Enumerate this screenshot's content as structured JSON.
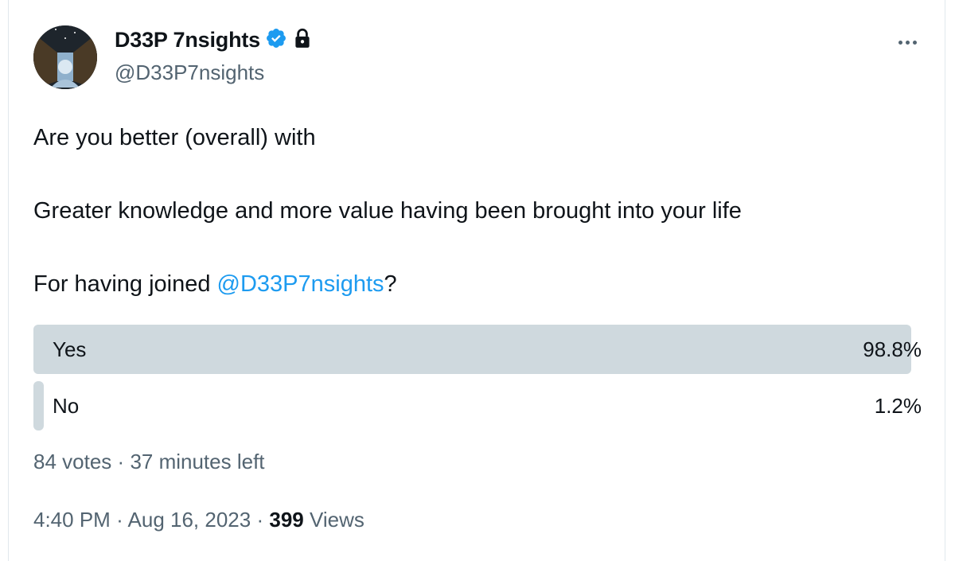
{
  "author": {
    "display_name": "D33P 7nsights",
    "handle": "@D33P7nsights",
    "verified_badge_icon": "verified-badge-icon",
    "protected_icon": "lock-icon",
    "verified_color": "#1d9bf0"
  },
  "more_menu_icon": "more-horizontal-icon",
  "tweet": {
    "line1": "Are you better (overall) with",
    "line2": "Greater knowledge and more value having been brought into your life",
    "line3_prefix": "For having joined ",
    "line3_mention": "@D33P7nsights",
    "line3_suffix": "?"
  },
  "poll": {
    "options": [
      {
        "label": "Yes",
        "percent_text": "98.8%",
        "percent": 98.8
      },
      {
        "label": "No",
        "percent_text": "1.2%",
        "percent": 1.2
      }
    ],
    "votes_text": "84 votes",
    "separator": "·",
    "time_left_text": "37 minutes left",
    "bar_color": "#cfd9de"
  },
  "footer": {
    "time": "4:40 PM",
    "separator": "·",
    "date": "Aug 16, 2023",
    "views_count": "399",
    "views_label": "Views"
  }
}
